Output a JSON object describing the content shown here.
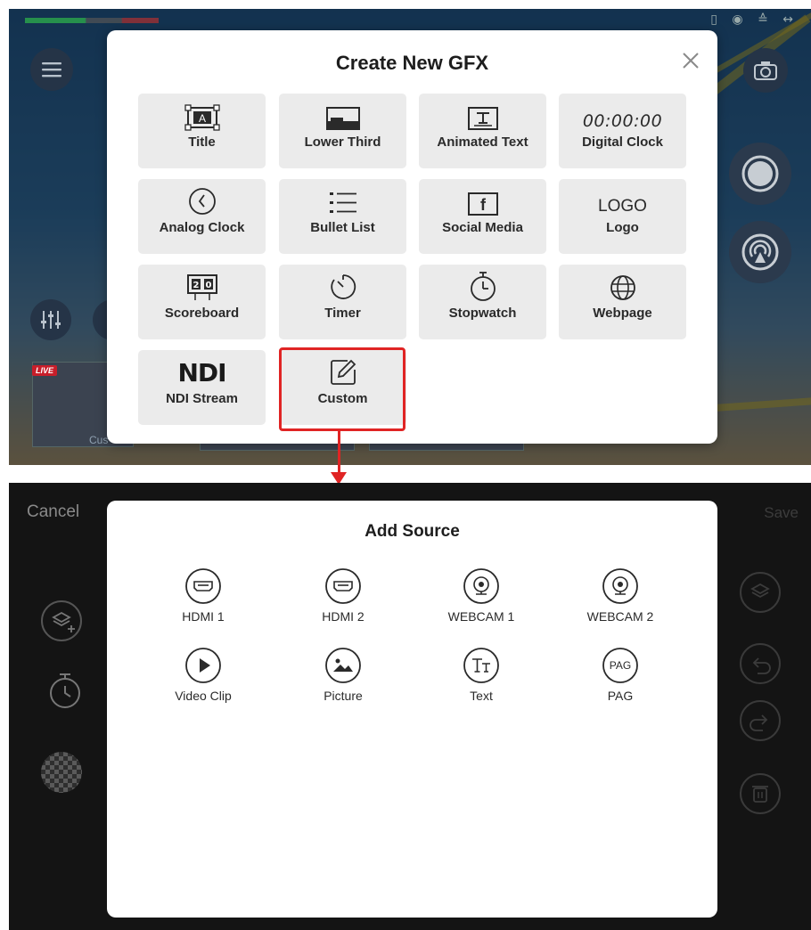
{
  "top_screen": {
    "live_badge": "LIVE",
    "tile_caption": "Cus",
    "status_icons": "▯ ◉ ≙ ↔"
  },
  "gfx_dialog": {
    "title": "Create New GFX",
    "tiles": [
      {
        "label": "Title",
        "icon": "title-frame-icon"
      },
      {
        "label": "Lower Third",
        "icon": "lower-third-icon"
      },
      {
        "label": "Animated Text",
        "icon": "animated-text-icon"
      },
      {
        "label": "Digital Clock",
        "icon": "digital-clock-icon",
        "icon_text": "00:00:00"
      },
      {
        "label": "Analog Clock",
        "icon": "analog-clock-icon"
      },
      {
        "label": "Bullet List",
        "icon": "bullet-list-icon"
      },
      {
        "label": "Social Media",
        "icon": "facebook-icon"
      },
      {
        "label": "Logo",
        "icon": "logo-text-icon",
        "icon_text": "LOGO"
      },
      {
        "label": "Scoreboard",
        "icon": "scoreboard-icon"
      },
      {
        "label": "Timer",
        "icon": "timer-icon"
      },
      {
        "label": "Stopwatch",
        "icon": "stopwatch-icon"
      },
      {
        "label": "Webpage",
        "icon": "globe-icon"
      },
      {
        "label": "NDI Stream",
        "icon": "ndi-logo-icon",
        "icon_text": "NDI"
      },
      {
        "label": "Custom",
        "icon": "edit-pencil-icon"
      }
    ]
  },
  "bottom_screen": {
    "cancel_label": "Cancel",
    "save_label": "Save"
  },
  "source_dialog": {
    "title": "Add Source",
    "items": [
      {
        "label": "HDMI 1",
        "icon": "hdmi-icon"
      },
      {
        "label": "HDMI 2",
        "icon": "hdmi-icon"
      },
      {
        "label": "WEBCAM 1",
        "icon": "webcam-icon"
      },
      {
        "label": "WEBCAM 2",
        "icon": "webcam-icon"
      },
      {
        "label": "Video Clip",
        "icon": "play-icon"
      },
      {
        "label": "Picture",
        "icon": "picture-icon"
      },
      {
        "label": "Text",
        "icon": "text-icon"
      },
      {
        "label": "PAG",
        "icon": "pag-icon",
        "icon_text": "PAG"
      }
    ]
  },
  "colors": {
    "highlight": "#e02424",
    "tile_bg": "#ebebeb",
    "dark_bg": "#141414"
  }
}
